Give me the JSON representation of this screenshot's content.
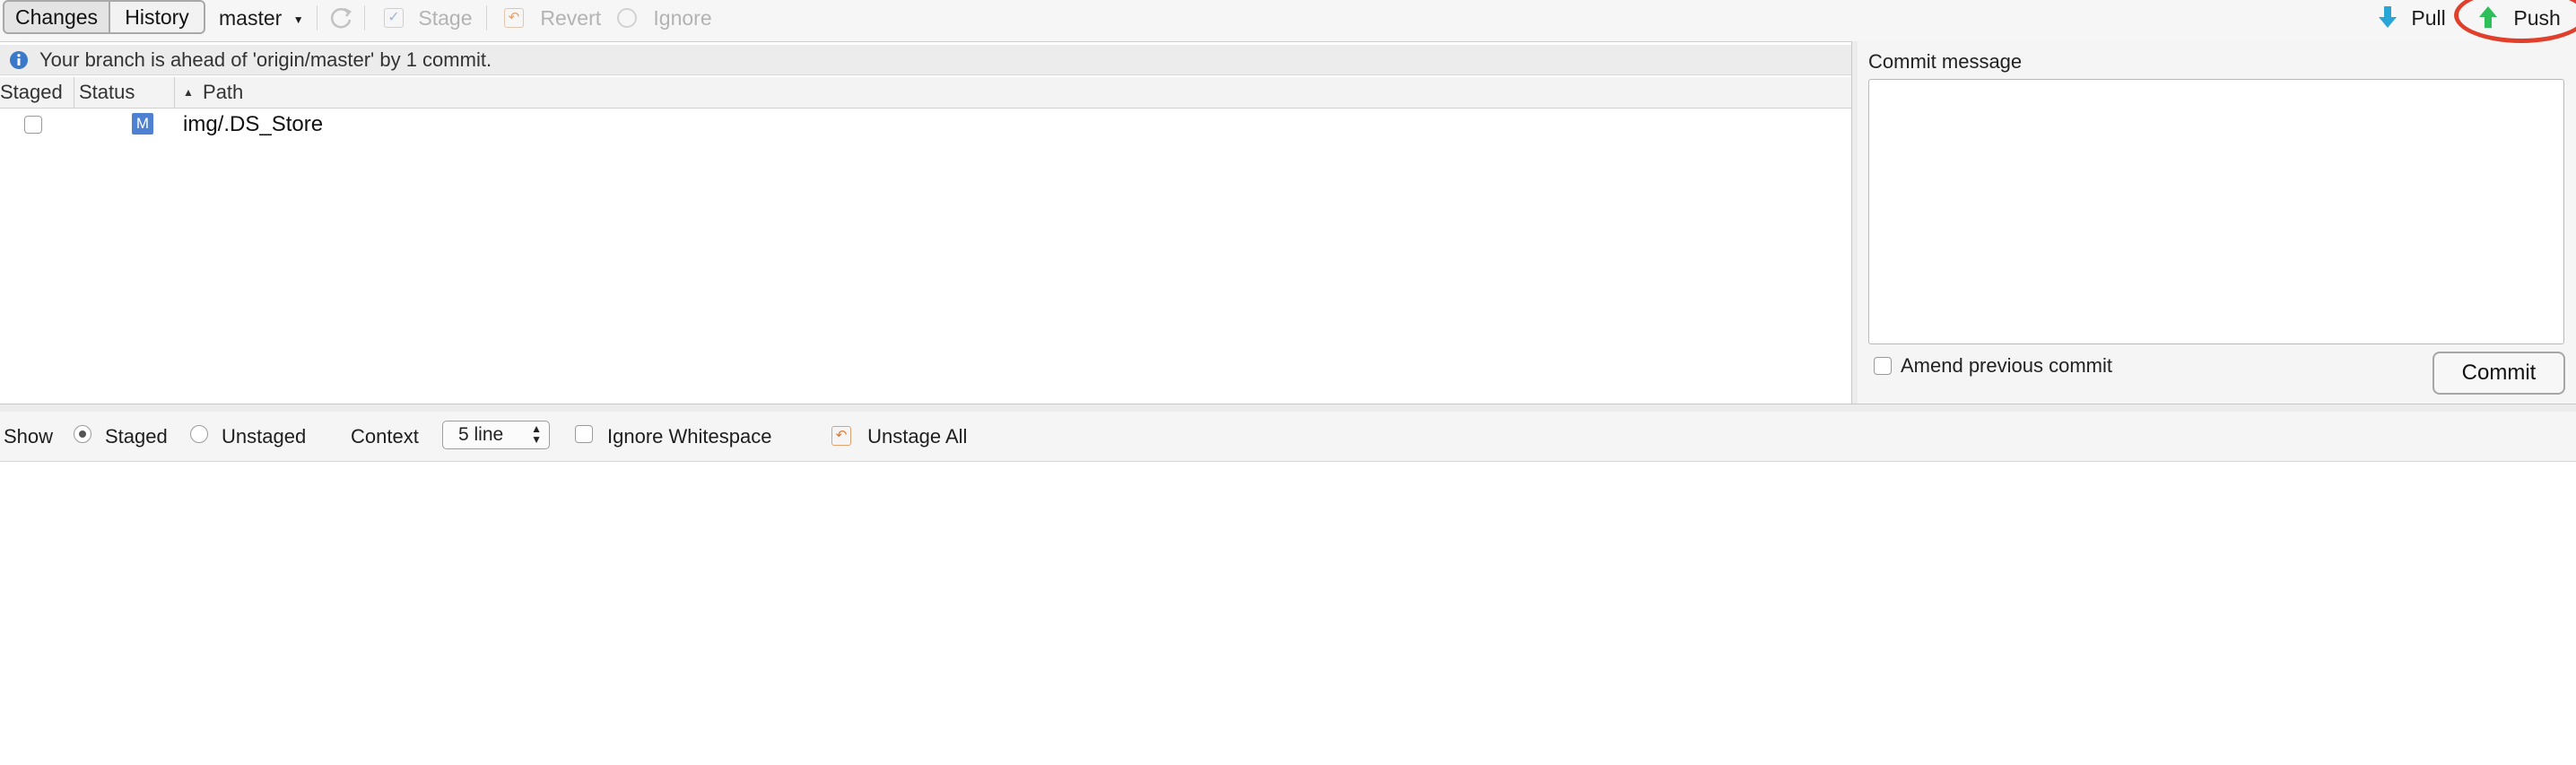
{
  "toolbar": {
    "tabs": [
      {
        "label": "Changes",
        "selected": true
      },
      {
        "label": "History",
        "selected": false
      }
    ],
    "branch": "master",
    "stage": "Stage",
    "revert": "Revert",
    "ignore": "Ignore",
    "pull": "Pull",
    "push": "Push"
  },
  "info": {
    "message": "Your branch is ahead of 'origin/master' by 1 commit."
  },
  "table": {
    "columns": [
      "Staged",
      "Status",
      "Path"
    ],
    "sort_column": "Path",
    "sort_direction": "ascending",
    "rows": [
      {
        "staged": false,
        "status": "M",
        "path": "img/.DS_Store"
      }
    ]
  },
  "commit": {
    "label": "Commit message",
    "message": "",
    "amend_label": "Amend previous commit",
    "amend_checked": false,
    "button": "Commit"
  },
  "diff_options": {
    "show_label": "Show",
    "staged_label": "Staged",
    "unstaged_label": "Unstaged",
    "selected": "Staged",
    "context_label": "Context",
    "context_value": "5 line",
    "ignore_whitespace_label": "Ignore Whitespace",
    "ignore_whitespace_checked": false,
    "unstage_all": "Unstage All"
  },
  "colors": {
    "annotation": "#e0402b",
    "status_badge": "#4f81d2",
    "pull_arrow": "#2aa6d6",
    "push_arrow": "#2fbf5a",
    "info_icon": "#3a78c9"
  },
  "icons": [
    "info-icon",
    "refresh-icon",
    "stage-check-icon",
    "revert-icon",
    "ignore-icon",
    "pull-arrow-icon",
    "push-arrow-icon",
    "unstage-all-icon",
    "sort-up-icon",
    "dropdown-caret-icon"
  ]
}
